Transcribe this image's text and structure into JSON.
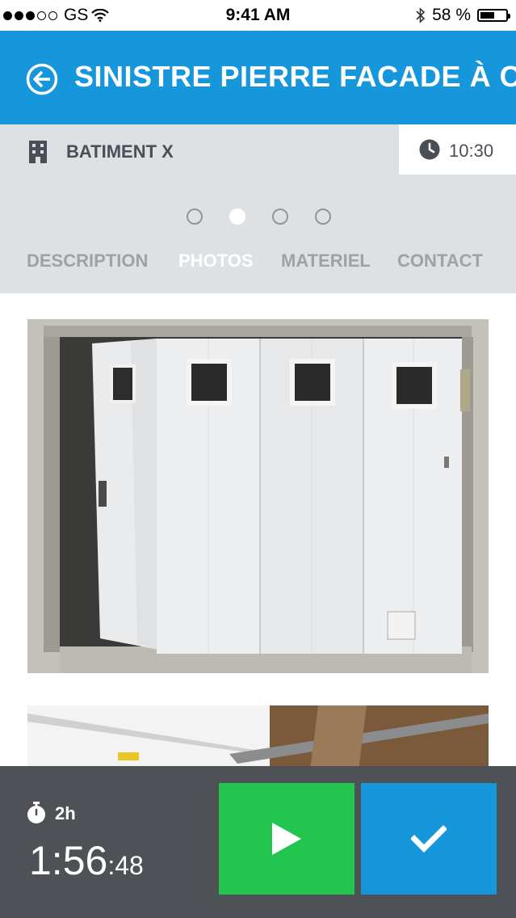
{
  "status_bar": {
    "carrier": "GS",
    "time": "9:41 AM",
    "battery": "58 %",
    "battery_level": 0.58
  },
  "header": {
    "title": "SINISTRE PIERRE FACADE À COTÉ",
    "back_icon": "back-circle-arrow-icon",
    "color": "#1797db"
  },
  "info": {
    "building_icon": "building-icon",
    "building_label": "BATIMENT X",
    "clock_icon": "clock-icon",
    "time": "10:30"
  },
  "pager": {
    "count": 4,
    "active_index": 1
  },
  "tabs": [
    {
      "label": "DESCRIPTION",
      "active": false
    },
    {
      "label": "PHOTOS",
      "active": true
    },
    {
      "label": "MATERIEL",
      "active": false
    },
    {
      "label": "CONTACT",
      "active": false
    }
  ],
  "photos": [
    {
      "subject": "garage-door-photo"
    },
    {
      "subject": "garage-ceiling-photo"
    }
  ],
  "bottom_bar": {
    "stopwatch_icon": "stopwatch-icon",
    "duration": "2h",
    "timer_main": "1:56",
    "timer_seconds": ":48",
    "play_icon": "play-icon",
    "check_icon": "check-icon",
    "play_color": "#22c550",
    "check_color": "#1797db"
  }
}
